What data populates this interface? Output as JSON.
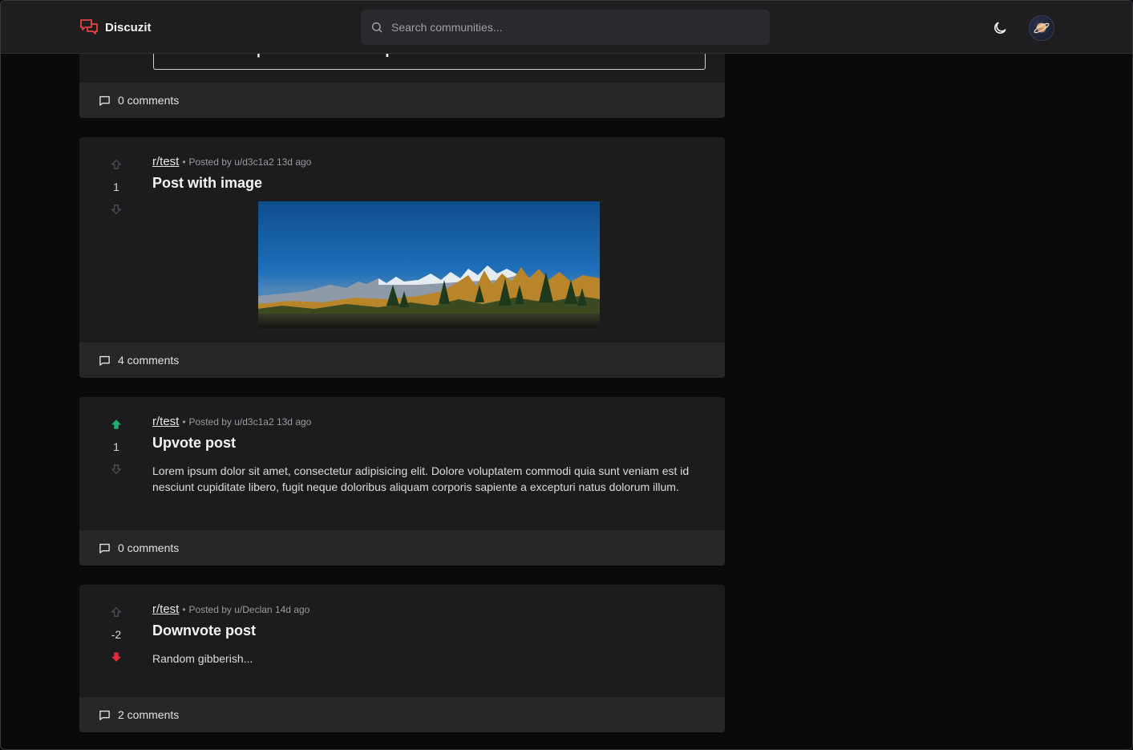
{
  "header": {
    "brand": "Discuzit",
    "search_placeholder": "Search communities..."
  },
  "posts": [
    {
      "embed_title": "Declan Seo | Frontend Developer",
      "comments": "0 comments"
    },
    {
      "community": "r/test",
      "meta": "Posted by u/d3c1a2 13d ago",
      "score": "1",
      "title": "Post with image",
      "vote": "none",
      "comments": "4 comments"
    },
    {
      "community": "r/test",
      "meta": "Posted by u/d3c1a2 13d ago",
      "score": "1",
      "title": "Upvote post",
      "body": "Lorem ipsum dolor sit amet, consectetur adipisicing elit. Dolore voluptatem commodi quia sunt veniam est id nesciunt cupiditate libero, fugit neque doloribus aliquam corporis sapiente a excepturi natus dolorum illum.",
      "vote": "up",
      "comments": "0 comments"
    },
    {
      "community": "r/test",
      "meta": "Posted by u/Declan 14d ago",
      "score": "-2",
      "title": "Downvote post",
      "body": "Random gibberish...",
      "vote": "down",
      "comments": "2 comments"
    }
  ],
  "colors": {
    "upvote_active": "#1fae6f",
    "downvote_active": "#e5293b",
    "brand_icon": "#e8453c"
  }
}
